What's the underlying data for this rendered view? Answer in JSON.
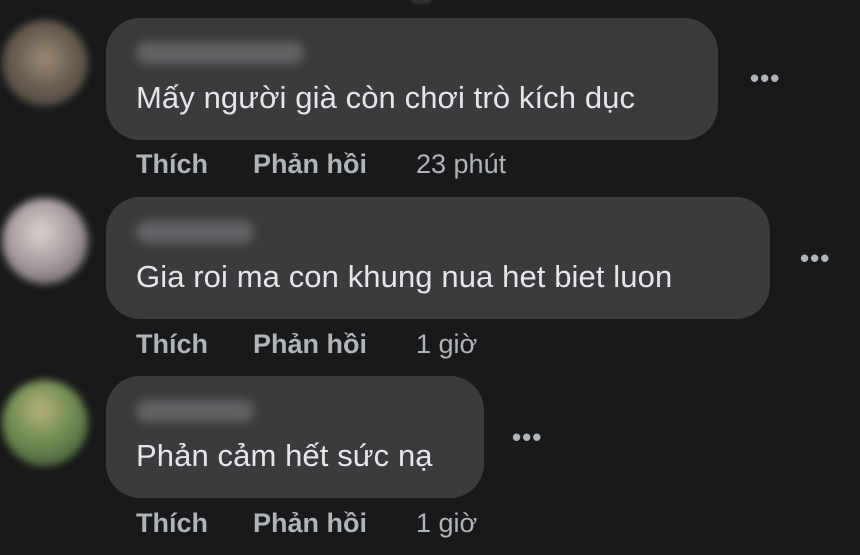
{
  "comments": [
    {
      "text": "Mấy người già còn chơi trò kích dục",
      "like_label": "Thích",
      "reply_label": "Phản hồi",
      "time": "23 phút",
      "more_icon": "•••"
    },
    {
      "text": "Gia roi ma con khung nua het biet luon",
      "like_label": "Thích",
      "reply_label": "Phản hồi",
      "time": "1 giờ",
      "more_icon": "•••"
    },
    {
      "text": "Phản cảm hết sức nạ",
      "like_label": "Thích",
      "reply_label": "Phản hồi",
      "time": "1 giờ",
      "more_icon": "•••"
    }
  ],
  "colors": {
    "background": "#18191a",
    "bubble": "#3a3b3c",
    "text": "#e4e6eb",
    "secondary_text": "#b0b3b8"
  }
}
